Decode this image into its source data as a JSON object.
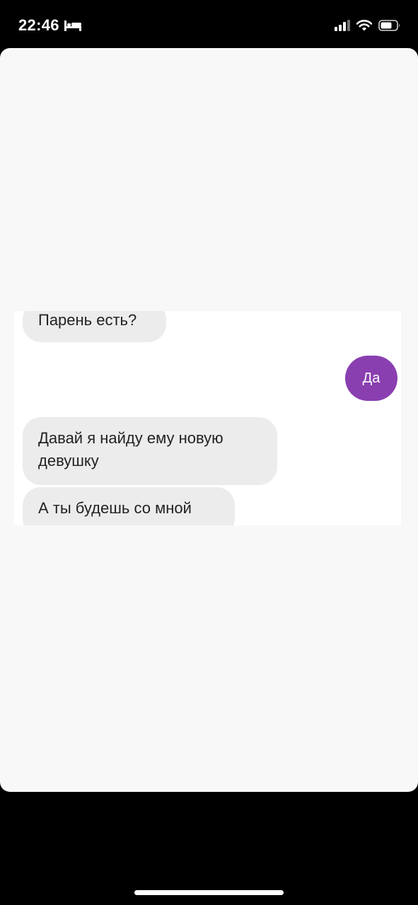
{
  "status_bar": {
    "time": "22:46",
    "icons": [
      "bed-icon",
      "cellular-signal-icon",
      "wifi-icon",
      "battery-icon"
    ],
    "text_color": "#ffffff"
  },
  "conversation": {
    "messages": [
      {
        "sender": "other",
        "text": "Парень есть?"
      },
      {
        "sender": "me",
        "text": "Да"
      },
      {
        "sender": "other",
        "text": "Давай я найду ему новую девушку"
      },
      {
        "sender": "other",
        "text": "А ты будешь со мной"
      }
    ]
  },
  "colors": {
    "incoming_bubble": "#ececec",
    "outgoing_bubble": "#8a3fb0",
    "sheet_background": "#f8f8f8",
    "screen_background": "#000000"
  }
}
